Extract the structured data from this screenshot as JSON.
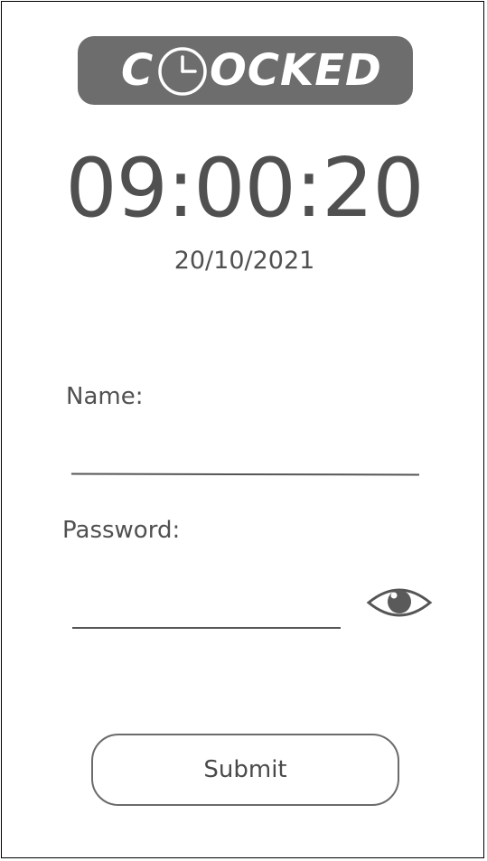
{
  "logo": {
    "letter_c": "C",
    "letters_rest": "OCKED",
    "icon": "clock-icon",
    "bg_color": "#6d6d6d",
    "text_color": "#ffffff"
  },
  "clock": {
    "time": "09:00:20",
    "date": "20/10/2021"
  },
  "form": {
    "name_label": "Name:",
    "name_value": "",
    "password_label": "Password:",
    "password_value": "",
    "password_toggle_icon": "eye-icon",
    "submit_label": "Submit"
  }
}
